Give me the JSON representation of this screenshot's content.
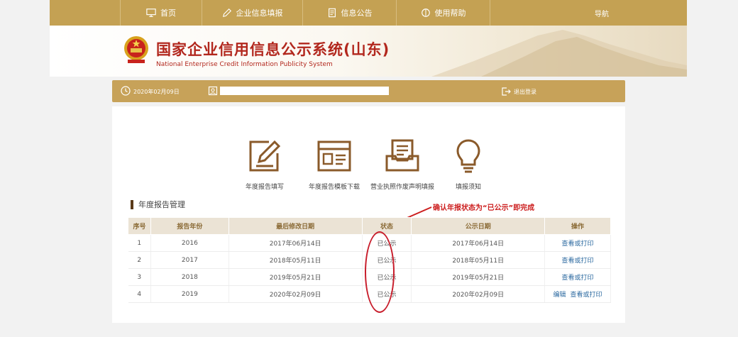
{
  "nav": {
    "items": [
      {
        "label": "首页",
        "icon": "monitor-icon"
      },
      {
        "label": "企业信息填报",
        "icon": "edit-icon"
      },
      {
        "label": "信息公告",
        "icon": "document-icon"
      },
      {
        "label": "使用帮助",
        "icon": "help-icon"
      }
    ],
    "guide": "导航"
  },
  "banner": {
    "title": "国家企业信用信息公示系统(山东)",
    "subtitle": "National Enterprise Credit Information Publicity System"
  },
  "userbar": {
    "date": "2020年02月09日",
    "logout": "退出登录"
  },
  "features": [
    {
      "label": "年度报告填写",
      "icon": "write-report-icon"
    },
    {
      "label": "年度报告模板下载",
      "icon": "template-download-icon"
    },
    {
      "label": "营业执照作废声明填报",
      "icon": "license-tray-icon"
    },
    {
      "label": "填报须知",
      "icon": "lightbulb-icon"
    }
  ],
  "section": {
    "title": "年度报告管理"
  },
  "annotation": {
    "text": "确认年报状态为“已公示”即完成"
  },
  "table": {
    "headers": [
      "序号",
      "报告年份",
      "最后修改日期",
      "状态",
      "公示日期",
      "操作"
    ],
    "rows": [
      {
        "no": "1",
        "year": "2016",
        "modified": "2017年06月14日",
        "status": "已公示",
        "published": "2017年06月14日",
        "ops": [
          "查看或打印"
        ]
      },
      {
        "no": "2",
        "year": "2017",
        "modified": "2018年05月11日",
        "status": "已公示",
        "published": "2018年05月11日",
        "ops": [
          "查看或打印"
        ]
      },
      {
        "no": "3",
        "year": "2018",
        "modified": "2019年05月21日",
        "status": "已公示",
        "published": "2019年05月21日",
        "ops": [
          "查看或打印"
        ]
      },
      {
        "no": "4",
        "year": "2019",
        "modified": "2020年02月09日",
        "status": "已公示",
        "published": "2020年02月09日",
        "ops": [
          "编辑",
          "查看或打印"
        ]
      }
    ]
  },
  "colors": {
    "gold": "#c4a153",
    "title_red": "#b2271d",
    "link_blue": "#2c6aa0",
    "annotation_red": "#cc1d1d"
  }
}
